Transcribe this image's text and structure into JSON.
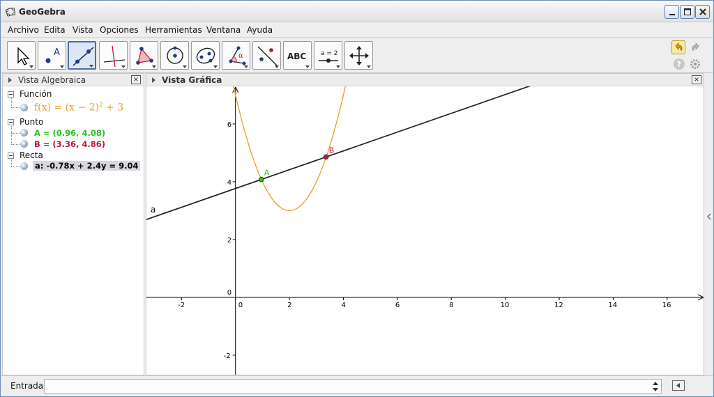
{
  "app": {
    "title": "GeoGebra"
  },
  "menu": [
    "Archivo",
    "Edita",
    "Vista",
    "Opciones",
    "Herramientas",
    "Ventana",
    "Ayuda"
  ],
  "toolbar": {
    "tools": [
      {
        "name": "move-tool-icon",
        "active": false
      },
      {
        "name": "point-tool-icon",
        "active": false
      },
      {
        "name": "line-tool-icon",
        "active": true
      },
      {
        "name": "perpendicular-tool-icon",
        "active": false
      },
      {
        "name": "polygon-tool-icon",
        "active": false
      },
      {
        "name": "circle-tool-icon",
        "active": false
      },
      {
        "name": "conic-tool-icon",
        "active": false
      },
      {
        "name": "angle-tool-icon",
        "active": false
      },
      {
        "name": "reflect-tool-icon",
        "active": false
      },
      {
        "name": "text-tool-icon",
        "active": false,
        "label": "ABC"
      },
      {
        "name": "slider-tool-icon",
        "active": false,
        "label": "a = 2"
      },
      {
        "name": "move-view-tool-icon",
        "active": false
      }
    ]
  },
  "algebra_view": {
    "title": "Vista Algebraica",
    "close": "×",
    "categories": {
      "funcion": "Función",
      "punto": "Punto",
      "recta": "Recta"
    },
    "function": {
      "name_base": "f(x) = (x − 2)",
      "exponent": "2",
      "tail": " + 3",
      "color": "#e6a020"
    },
    "points": [
      {
        "text": "A = (0.96, 4.08)",
        "color": "#27c21f"
      },
      {
        "text": "B = (3.36, 4.86)",
        "color": "#c0143c"
      }
    ],
    "line": {
      "text": "a: -0.78x + 2.4y = 9.04"
    }
  },
  "graphics_view": {
    "title": "Vista Gráfica",
    "close": "×"
  },
  "chart_data": {
    "type": "line",
    "xlim": [
      -3.3,
      17.4
    ],
    "ylim": [
      -2.7,
      7.3
    ],
    "x_ticks": [
      -2,
      0,
      2,
      4,
      6,
      8,
      10,
      12,
      14,
      16
    ],
    "y_ticks": [
      -2,
      0,
      2,
      4,
      6
    ],
    "grid": false,
    "function": {
      "label": "f",
      "expression": "(x − 2)^2 + 3",
      "color": "#e6a020"
    },
    "line": {
      "label": "a",
      "a": -0.78,
      "b": 2.4,
      "c": 9.04,
      "color": "#222222"
    },
    "points": [
      {
        "label": "A",
        "x": 0.96,
        "y": 4.08,
        "color": "#27c21f"
      },
      {
        "label": "B",
        "x": 3.36,
        "y": 4.86,
        "color": "#c0143c"
      }
    ]
  },
  "input_bar": {
    "label": "Entrada:",
    "value": "",
    "placeholder": ""
  }
}
